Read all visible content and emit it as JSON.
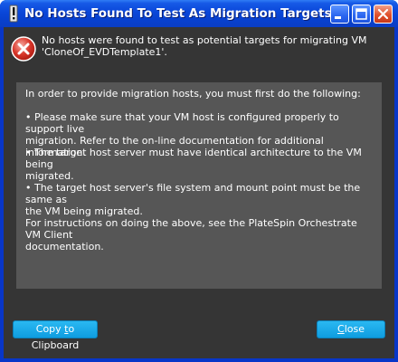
{
  "window": {
    "title": "No Hosts Found To Test As Migration Targets"
  },
  "header": {
    "message": "No hosts were found to test as potential targets for migrating VM\n'CloneOf_EVDTemplate1'."
  },
  "instructions": {
    "intro": "In order to provide migration hosts, you must first do the following:",
    "bullet1": "• Please make sure that your VM host is configured properly to support live\nmigration.  Refer to the on-line documentation for additional information.",
    "bullet2": "• The target host server must have identical architecture to the VM being\nmigrated.",
    "bullet3": "• The target host server's file system and mount point must be the same as\nthe VM being migrated.",
    "footer": "For instructions on doing the above, see the PlateSpin Orchestrate VM Client\ndocumentation."
  },
  "buttons": {
    "copy_pre": "Copy ",
    "copy_mnemonic": "t",
    "copy_post": "o Clipboard",
    "close_pre": "",
    "close_mnemonic": "C",
    "close_post": "lose"
  },
  "icons": {
    "app": "exclamation-icon",
    "error": "error-x-icon",
    "minimize": "minimize-icon",
    "maximize": "maximize-icon",
    "close": "close-icon"
  },
  "colors": {
    "titlebar": "#0a47d9",
    "client_bg": "#353535",
    "panel_bg": "#565656",
    "button_bg": "#1aa9e8",
    "error_red": "#d8362a"
  }
}
